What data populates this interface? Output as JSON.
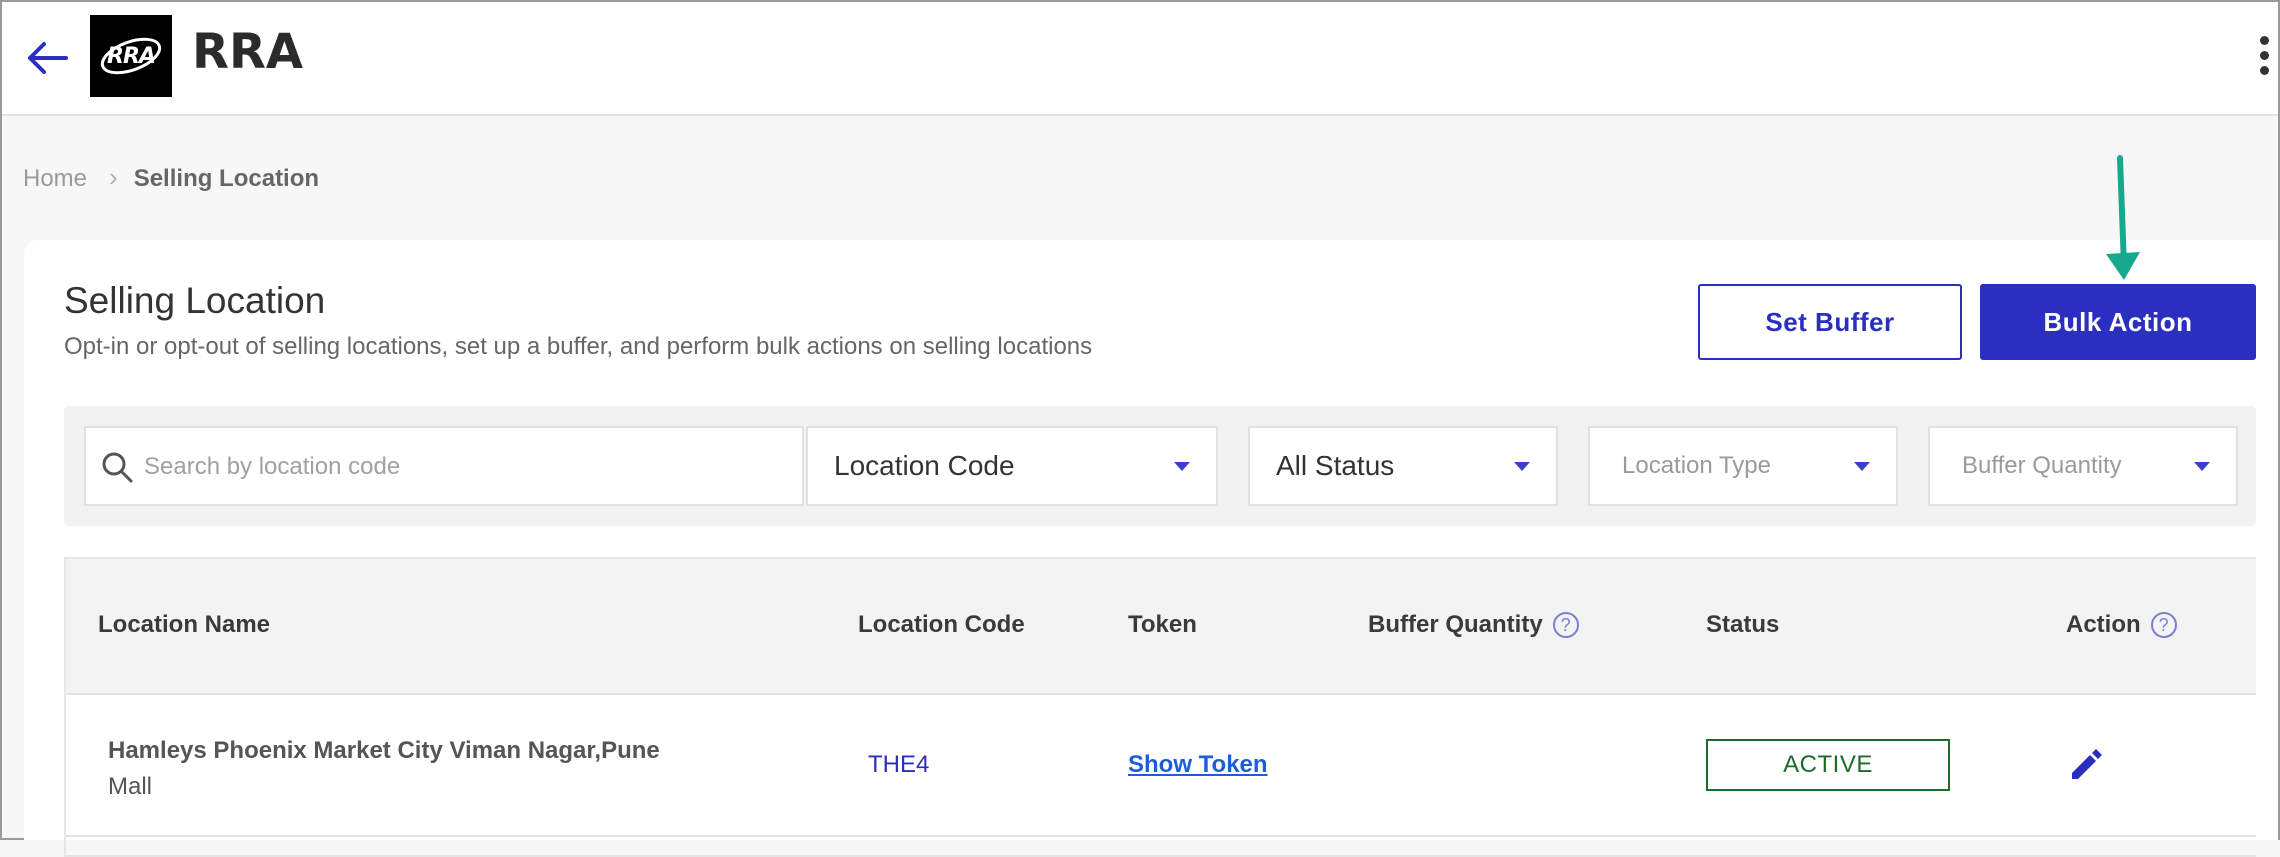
{
  "header": {
    "app_title": "RRA",
    "logo_text": "RRA",
    "back_icon": "arrow-left-icon",
    "menu_icon": "kebab-menu-icon"
  },
  "breadcrumb": {
    "home": "Home",
    "separator": "›",
    "current": "Selling Location"
  },
  "page": {
    "title": "Selling Location",
    "subtitle": "Opt-in or opt-out of selling locations, set up a buffer, and perform bulk actions on selling locations"
  },
  "actions": {
    "set_buffer": "Set Buffer",
    "bulk_action": "Bulk Action"
  },
  "filters": {
    "search_placeholder": "Search by location code",
    "search_value": "",
    "search_by": "Location Code",
    "status": "All Status",
    "location_type_placeholder": "Location Type",
    "buffer_quantity_placeholder": "Buffer Quantity"
  },
  "table": {
    "columns": [
      "Location Name",
      "Location Code",
      "Token",
      "Buffer Quantity",
      "Status",
      "Action"
    ],
    "rows": [
      {
        "location_name": "Hamleys Phoenix Market City Viman Nagar,Pune",
        "location_type": "Mall",
        "location_code": "THE4",
        "token": "Show Token",
        "buffer_quantity": "",
        "status": "ACTIVE"
      }
    ]
  },
  "colors": {
    "primary": "#2b2fbf",
    "annotation_arrow": "#17a98e",
    "status_active": "#1f6b2c",
    "link": "#1d5ed8"
  }
}
